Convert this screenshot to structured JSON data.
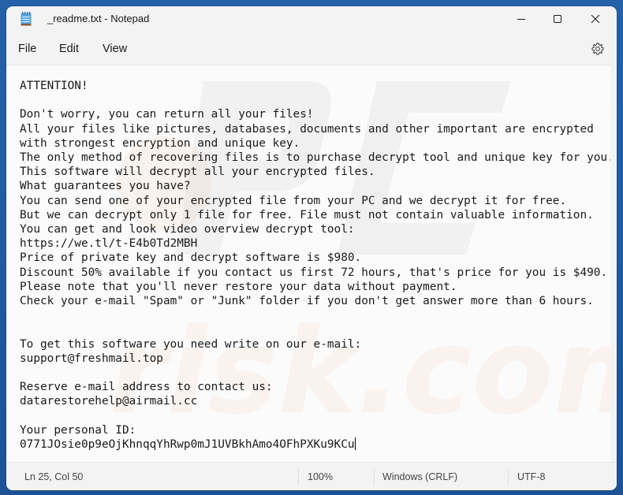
{
  "window": {
    "title": "_readme.txt - Notepad",
    "app_icon": "notepad-icon",
    "controls": {
      "minimize": "minimize-icon",
      "maximize": "maximize-icon",
      "close": "close-icon"
    }
  },
  "menu": {
    "items": [
      {
        "label": "File"
      },
      {
        "label": "Edit"
      },
      {
        "label": "View"
      }
    ],
    "settings_icon": "gear-icon"
  },
  "editor": {
    "lines": [
      "ATTENTION!",
      "",
      "Don't worry, you can return all your files!",
      "All your files like pictures, databases, documents and other important are encrypted",
      "with strongest encryption and unique key.",
      "The only method of recovering files is to purchase decrypt tool and unique key for you.",
      "This software will decrypt all your encrypted files.",
      "What guarantees you have?",
      "You can send one of your encrypted file from your PC and we decrypt it for free.",
      "But we can decrypt only 1 file for free. File must not contain valuable information.",
      "You can get and look video overview decrypt tool:",
      "https://we.tl/t-E4b0Td2MBH",
      "Price of private key and decrypt software is $980.",
      "Discount 50% available if you contact us first 72 hours, that's price for you is $490.",
      "Please note that you'll never restore your data without payment.",
      "Check your e-mail \"Spam\" or \"Junk\" folder if you don't get answer more than 6 hours.",
      "",
      "",
      "To get this software you need write on our e-mail:",
      "support@freshmail.top",
      "",
      "Reserve e-mail address to contact us:",
      "datarestorehelp@airmail.cc",
      "",
      "Your personal ID:",
      "0771JOsie0p9eOjKhnqqYhRwp0mJ1UVBkhAmo4OFhPXKu9KCu"
    ],
    "watermark_text": "PC risk.com"
  },
  "status": {
    "position": "Ln 25, Col 50",
    "zoom": "100%",
    "line_ending": "Windows (CRLF)",
    "encoding": "UTF-8"
  },
  "colors": {
    "desktop": "#1f5aa0",
    "window_bg": "#f3f3f3",
    "editor_bg": "#fbfbfb",
    "text": "#1a1a1a"
  }
}
